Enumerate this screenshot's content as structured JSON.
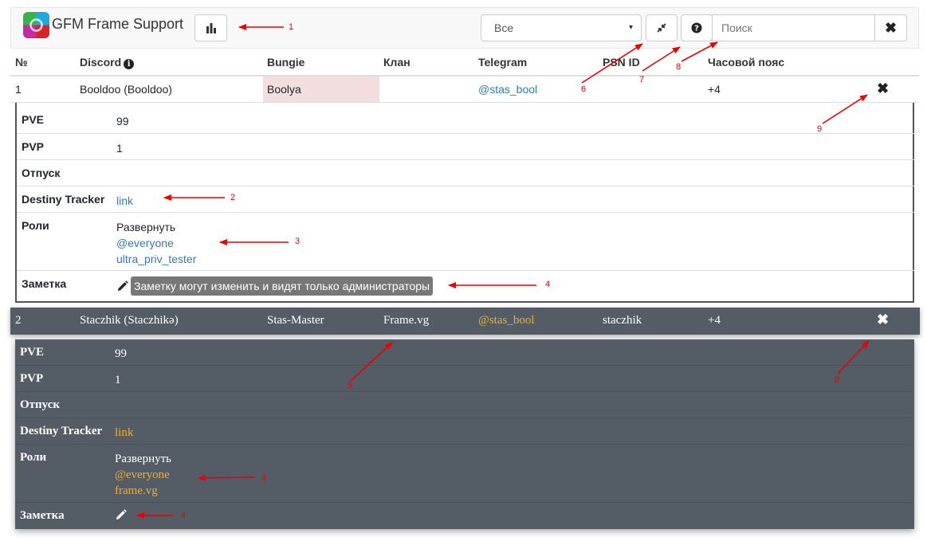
{
  "navbar": {
    "brand": "GFM Frame Support",
    "filter_selected": "Все",
    "search_placeholder": "Поиск",
    "clear_label": "✖"
  },
  "table": {
    "headers": [
      "№",
      "Discord",
      "Bungie",
      "Клан",
      "Telegram",
      "PSN ID",
      "Часовой пояс"
    ]
  },
  "rows": [
    {
      "num": "1",
      "discord": "Booldoo (Booldoo)",
      "bungie": "Boolya",
      "clan": "",
      "telegram": "@stas_bool",
      "psn": "",
      "tz": "+4",
      "delete": "✖",
      "details": {
        "pve_label": "PVE",
        "pve": "99",
        "pvp_label": "PVP",
        "pvp": "1",
        "vacation_label": "Отпуск",
        "vacation": "",
        "tracker_label": "Destiny Tracker",
        "tracker": "link",
        "roles_label": "Роли",
        "roles_expand": "Развернуть",
        "roles": [
          "@everyone",
          "ultra_priv_tester"
        ],
        "note_label": "Заметка",
        "note": "Заметку могут изменить и видят только администраторы"
      }
    },
    {
      "num": "2",
      "discord": "Staczhik (Staczhikə)",
      "bungie": "Stas-Master",
      "clan": "Frame.vg",
      "telegram": "@stas_bool",
      "psn": "staczhik",
      "tz": "+4",
      "delete": "✖",
      "details": {
        "pve_label": "PVE",
        "pve": "99",
        "pvp_label": "PVP",
        "pvp": "1",
        "vacation_label": "Отпуск",
        "vacation": "",
        "tracker_label": "Destiny Tracker",
        "tracker": "link",
        "roles_label": "Роли",
        "roles_expand": "Развернуть",
        "roles": [
          "@everyone",
          "frame.vg"
        ],
        "note_label": "Заметка",
        "note": ""
      }
    }
  ],
  "annotations": [
    "1",
    "2",
    "3",
    "4",
    "5",
    "6",
    "7",
    "8",
    "9"
  ],
  "colors": {
    "arrow": "#ee0000",
    "dark_row": "#545c66",
    "link": "#337ab7",
    "dark_link": "#f0ad2e",
    "highlight": "#f2dede"
  },
  "icons": [
    "bar-chart-icon",
    "compress-icon",
    "question-circle-icon",
    "close-icon",
    "info-circle-icon",
    "pencil-icon"
  ]
}
